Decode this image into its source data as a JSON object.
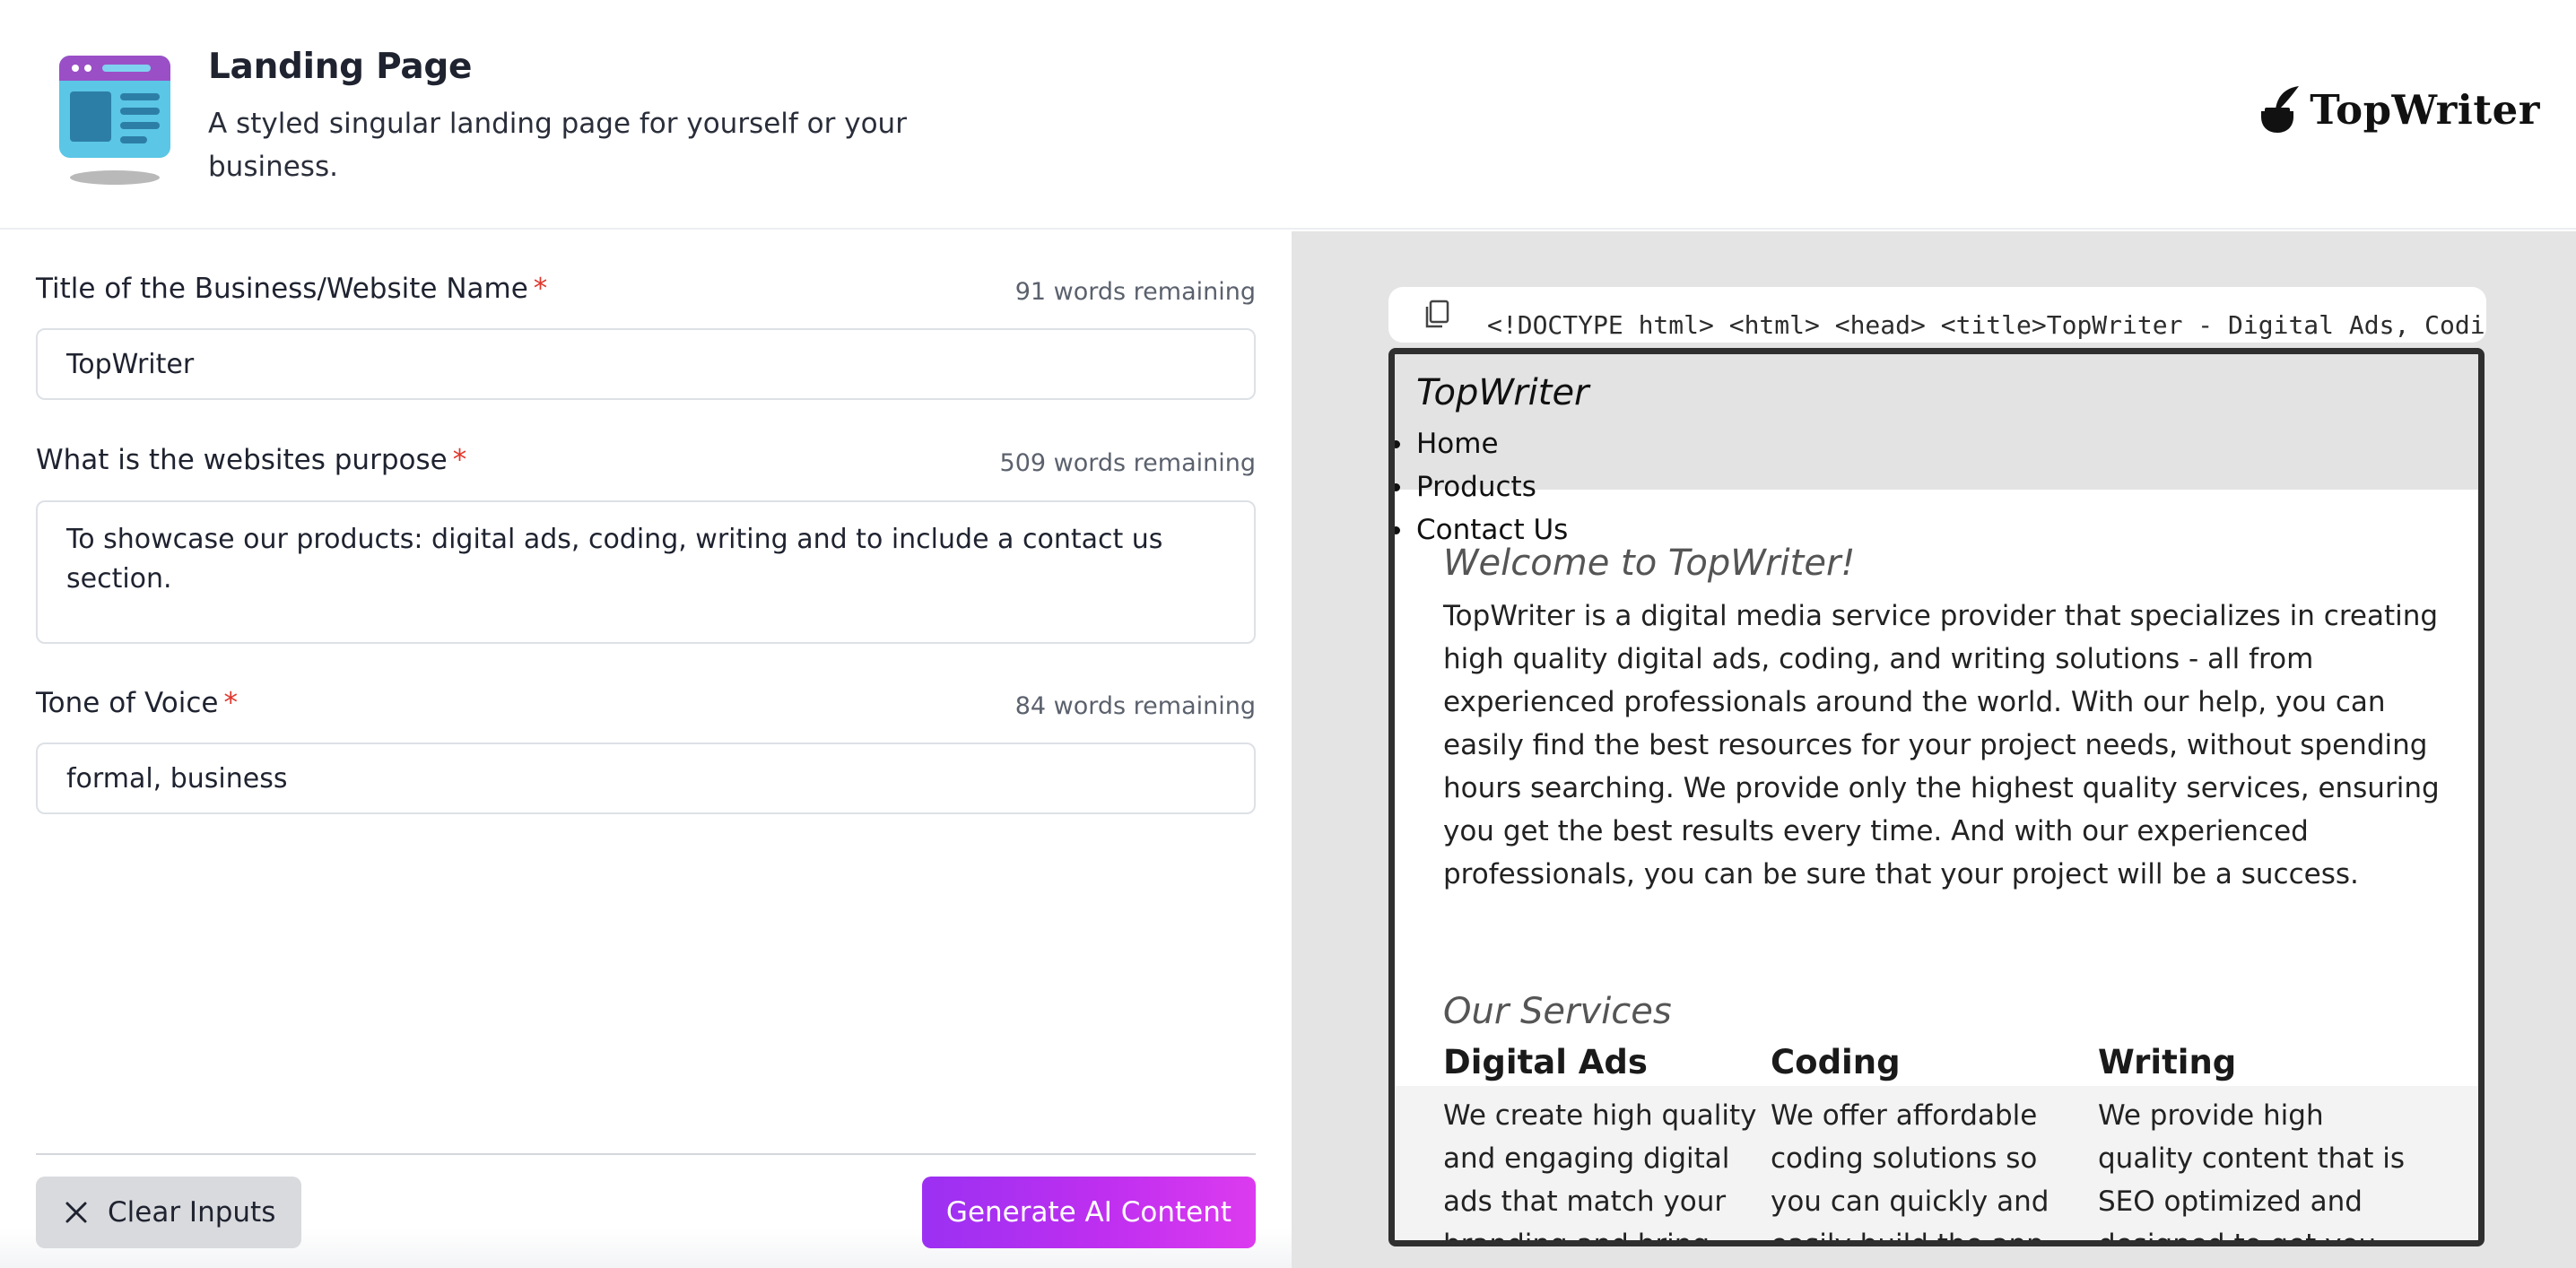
{
  "header": {
    "title": "Landing Page",
    "subtitle": "A styled singular landing page for yourself or your business.",
    "tool_icon": "landing-page-icon",
    "brand": {
      "logo_icon": "inkwell-quill-icon",
      "text": "TopWriter"
    }
  },
  "form": {
    "fields": [
      {
        "label": "Title of the Business/Website Name",
        "required_mark": "*",
        "counter": "91 words remaining",
        "value": "TopWriter"
      },
      {
        "label": "What is the websites purpose",
        "required_mark": "*",
        "counter": "509 words remaining",
        "value": "To showcase our products: digital ads, coding, writing and to include a contact us section."
      },
      {
        "label": "Tone of Voice",
        "required_mark": "*",
        "counter": "84 words remaining",
        "value": "formal, business"
      }
    ],
    "clear_button": {
      "label": "Clear Inputs",
      "icon": "close-icon"
    },
    "generate_button": {
      "label": "Generate AI Content"
    }
  },
  "preview": {
    "code_snippet": "<!DOCTYPE html> <html> <head> <title>TopWriter - Digital Ads, Codi",
    "copy_icon": "copy-icon",
    "site": {
      "logo": "TopWriter",
      "nav": [
        "Home",
        "Products",
        "Contact Us"
      ],
      "welcome_heading": "Welcome to TopWriter!",
      "about": "TopWriter is a digital media service provider that specializes in creating high quality digital ads, coding, and writing solutions - all from experienced professionals around the world. With our help, you can easily find the best resources for your project needs, without spending hours searching. We provide only the highest quality services, ensuring you get the best results every time. And with our experienced professionals, you can be sure that your project will be a success.",
      "services_heading": "Our Services",
      "services": [
        {
          "title": "Digital Ads",
          "text": "We create high quality and engaging digital ads that match your branding and bring your"
        },
        {
          "title": "Coding",
          "text": "We offer affordable coding solutions so you can quickly and easily build the app you need"
        },
        {
          "title": "Writing",
          "text": "We provide high quality content that is SEO optimized and designed to get you noticed. Our"
        }
      ]
    }
  },
  "colors": {
    "required": "#e0362c",
    "generate_gradient_start": "#9b30f2",
    "generate_gradient_end": "#dc3bef",
    "preview_background": "#e4e4e4"
  }
}
